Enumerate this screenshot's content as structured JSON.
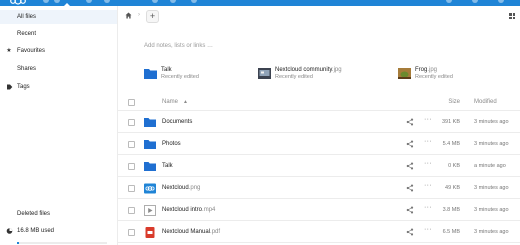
{
  "colors": {
    "brand": "#1f84d6",
    "folder": "#1f6fd1",
    "active_nav_bg": "#eef4fb"
  },
  "sidebar": {
    "items": [
      {
        "label": "All files",
        "icon": "folder-icon",
        "active": true
      },
      {
        "label": "Recent",
        "icon": "clock-icon",
        "active": false
      },
      {
        "label": "Favourites",
        "icon": "star-icon",
        "active": false
      },
      {
        "label": "Shares",
        "icon": "share-icon",
        "active": false
      },
      {
        "label": "Tags",
        "icon": "tag-icon",
        "active": false
      }
    ],
    "deleted_files": "Deleted files",
    "quota": {
      "label": "16.8 MB used",
      "fraction": 0.02
    }
  },
  "breadcrumb": {
    "home_icon": "home-icon",
    "add_button": "+"
  },
  "notes": {
    "placeholder": "Add notes, lists or links …"
  },
  "recent_files": [
    {
      "name": "Talk",
      "ext": "",
      "subtitle": "Recently edited",
      "icon": "folder-icon"
    },
    {
      "name": "Nextcloud community",
      "ext": ".jpg",
      "subtitle": "Recently edited",
      "icon": "image-thumbnail-icon"
    },
    {
      "name": "Frog",
      "ext": ".jpg",
      "subtitle": "Recently edited",
      "icon": "image-thumbnail-icon"
    }
  ],
  "table": {
    "columns": {
      "name": "Name",
      "size": "Size",
      "modified": "Modified"
    },
    "more_label": "···",
    "rows": [
      {
        "name": "Documents",
        "ext": "",
        "size": "391 KB",
        "modified": "3 minutes ago",
        "type": "folder"
      },
      {
        "name": "Photos",
        "ext": "",
        "size": "5.4 MB",
        "modified": "3 minutes ago",
        "type": "folder"
      },
      {
        "name": "Talk",
        "ext": "",
        "size": "0 KB",
        "modified": "a minute ago",
        "type": "folder"
      },
      {
        "name": "Nextcloud",
        "ext": ".png",
        "size": "49 KB",
        "modified": "3 minutes ago",
        "type": "image"
      },
      {
        "name": "Nextcloud intro",
        "ext": ".mp4",
        "size": "3.8 MB",
        "modified": "3 minutes ago",
        "type": "video"
      },
      {
        "name": "Nextcloud Manual",
        "ext": ".pdf",
        "size": "6.5 MB",
        "modified": "3 minutes ago",
        "type": "pdf"
      }
    ]
  }
}
